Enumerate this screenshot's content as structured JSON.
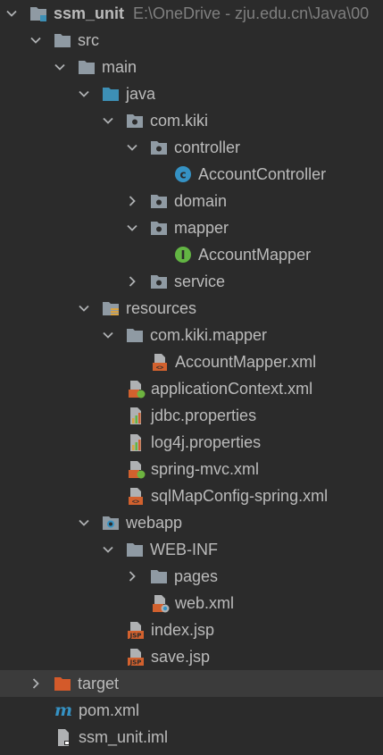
{
  "project": {
    "name": "ssm_unit",
    "path_hint": "E:\\OneDrive - zju.edu.cn\\Java\\00"
  },
  "tree": [
    {
      "label": "src",
      "icon": "folder-icon"
    },
    {
      "label": "main",
      "icon": "folder-icon"
    },
    {
      "label": "java",
      "icon": "source-folder-icon"
    },
    {
      "label": "com.kiki",
      "icon": "package-icon"
    },
    {
      "label": "controller",
      "icon": "package-icon"
    },
    {
      "label": "AccountController",
      "icon": "class-icon"
    },
    {
      "label": "domain",
      "icon": "package-icon"
    },
    {
      "label": "mapper",
      "icon": "package-icon"
    },
    {
      "label": "AccountMapper",
      "icon": "interface-icon"
    },
    {
      "label": "service",
      "icon": "package-icon"
    },
    {
      "label": "resources",
      "icon": "resources-folder-icon"
    },
    {
      "label": "com.kiki.mapper",
      "icon": "folder-icon"
    },
    {
      "label": "AccountMapper.xml",
      "icon": "xml-file-icon"
    },
    {
      "label": "applicationContext.xml",
      "icon": "spring-xml-icon"
    },
    {
      "label": "jdbc.properties",
      "icon": "properties-file-icon"
    },
    {
      "label": "log4j.properties",
      "icon": "properties-file-icon"
    },
    {
      "label": "spring-mvc.xml",
      "icon": "spring-xml-icon"
    },
    {
      "label": "sqlMapConfig-spring.xml",
      "icon": "xml-file-icon"
    },
    {
      "label": "webapp",
      "icon": "web-folder-icon"
    },
    {
      "label": "WEB-INF",
      "icon": "folder-icon"
    },
    {
      "label": "pages",
      "icon": "folder-icon"
    },
    {
      "label": "web.xml",
      "icon": "web-xml-icon"
    },
    {
      "label": "index.jsp",
      "icon": "jsp-file-icon"
    },
    {
      "label": "save.jsp",
      "icon": "jsp-file-icon"
    },
    {
      "label": "target",
      "icon": "excluded-folder-icon"
    },
    {
      "label": "pom.xml",
      "icon": "maven-icon"
    },
    {
      "label": "ssm_unit.iml",
      "icon": "iml-file-icon"
    }
  ],
  "colors": {
    "background": "#2b2b2b",
    "selected_row": "#3b3b3b",
    "text": "#bbbbbb",
    "hint": "#7f7f7f",
    "folder": "#8f9aa3",
    "source_folder": "#3d8fb5",
    "class_icon": "#3592c4",
    "interface_icon": "#62b543",
    "xml_icon": "#d2612e",
    "excluded_folder": "#d45a2a"
  }
}
